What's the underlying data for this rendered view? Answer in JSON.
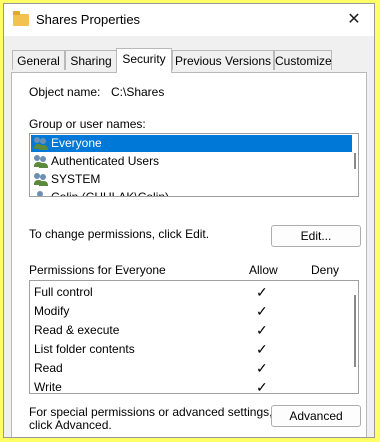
{
  "window": {
    "title": "Shares Properties",
    "close_glyph": "✕"
  },
  "tabs": [
    {
      "label": "General"
    },
    {
      "label": "Sharing"
    },
    {
      "label": "Security"
    },
    {
      "label": "Previous Versions"
    },
    {
      "label": "Customize"
    }
  ],
  "security": {
    "object_label": "Object name:",
    "object_value": "C:\\Shares",
    "group_label": "Group or user names:",
    "users": [
      {
        "name": "Everyone",
        "icon": "user-group-icon"
      },
      {
        "name": "Authenticated Users",
        "icon": "user-group-icon"
      },
      {
        "name": "SYSTEM",
        "icon": "user-group-icon"
      },
      {
        "name": "Colin (CHULAK\\Colin)",
        "icon": "user-icon"
      }
    ],
    "change_text": "To change permissions, click Edit.",
    "edit_label": "Edit...",
    "perm_header": "Permissions for Everyone",
    "allow_label": "Allow",
    "deny_label": "Deny",
    "permissions": [
      {
        "name": "Full control",
        "allow": "✓",
        "deny": ""
      },
      {
        "name": "Modify",
        "allow": "✓",
        "deny": ""
      },
      {
        "name": "Read & execute",
        "allow": "✓",
        "deny": ""
      },
      {
        "name": "List folder contents",
        "allow": "✓",
        "deny": ""
      },
      {
        "name": "Read",
        "allow": "✓",
        "deny": ""
      },
      {
        "name": "Write",
        "allow": "✓",
        "deny": ""
      }
    ],
    "special_text_1": "For special permissions or advanced settings,",
    "special_text_2": "click Advanced.",
    "advanced_label": "Advanced"
  },
  "colors": {
    "highlight": "#0078d7",
    "frame": "#ffff66"
  }
}
